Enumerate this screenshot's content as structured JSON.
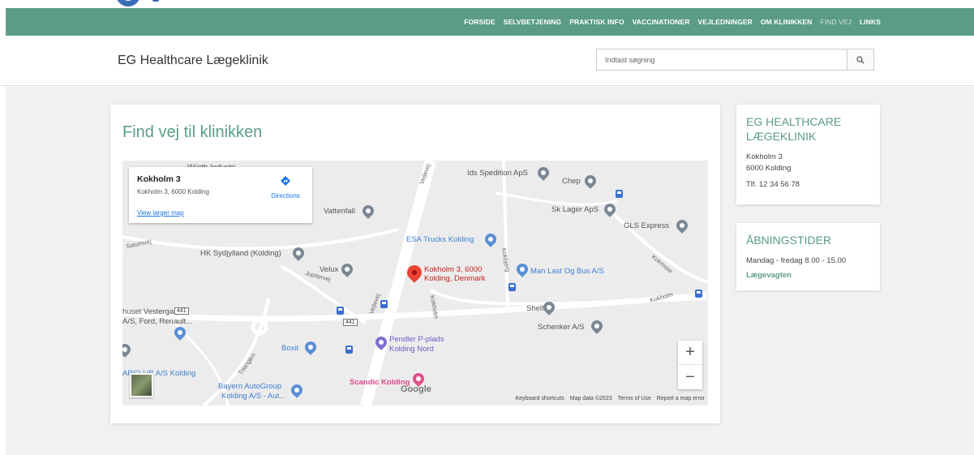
{
  "nav": {
    "items": [
      "FORSIDE",
      "SELVBETJENING",
      "PRAKTISK INFO",
      "VACCINATIONER",
      "VEJLEDNINGER",
      "OM KLINIKKEN",
      "FIND VEJ",
      "LINKS"
    ],
    "active": "FIND VEJ"
  },
  "header": {
    "site_title": "EG Healthcare Lægeklinik",
    "search_placeholder": "Indtast søgning"
  },
  "main": {
    "title": "Find vej til klinikken",
    "map": {
      "infobox": {
        "title": "Kokholm 3",
        "address": "Kokholm 3, 6000 Kolding",
        "directions": "Directions",
        "view_larger": "View larger map"
      },
      "marker_label_1": "Kokholm 3, 6000",
      "marker_label_2": "Kolding, Denmark",
      "places": {
        "wurth": "Würth Industri",
        "ids": "Ids Spedition ApS",
        "chep": "Chep",
        "vattenfall": "Vattenfall",
        "sk_lager": "Sk Lager ApS",
        "gls": "GLS Express",
        "esa": "ESA Trucks Kolding",
        "hk": "HK Sydjylland (Kolding)",
        "velux": "Velux",
        "man": "Man Last Og Bus A/S",
        "vestergaard_1": "huset Vestergaard",
        "vestergaard_2": "A/S, Ford, Renault...",
        "shell": "Shell",
        "schenker": "Schenker A/S",
        "boxit": "Boxit",
        "pendler_1": "Pendler P-plads",
        "pendler_2": "Kolding Nord",
        "arc": "ARCLUB A/S Kolding",
        "bayern_1": "Bayern AutoGroup",
        "bayern_2": "Kolding A/S - Aut...",
        "scandic": "Scandic Kolding"
      },
      "roads": {
        "vejlevej": "Vejlevej",
        "saturnvej": "Saturnvej",
        "jupitervej": "Jupitervej",
        "kokholm": "Kokholm",
        "kokbjerg": "Kokbjerg",
        "kokmose": "Kokmose",
        "trianglen": "Trianglen",
        "route": "441"
      },
      "google": "Google",
      "footer": [
        "Keyboard shortcuts",
        "Map data ©2023",
        "Terms of Use",
        "Report a map error"
      ],
      "zoom_in": "+",
      "zoom_out": "−"
    }
  },
  "contact": {
    "title": "EG HEALTHCARE LÆGEKLINIK",
    "street": "Kokholm 3",
    "city": "6000 Kolding",
    "phone": "Tlf. 12 34 56 78"
  },
  "hours": {
    "title": "ÅBNINGSTIDER",
    "weekday": "Mandag - fredag 8.00 - 15.00",
    "emergency_link": "Lægevagten"
  },
  "colors": {
    "brand": "#5b9c86",
    "link_blue": "#1a73e8",
    "marker_red": "#ea4335"
  }
}
